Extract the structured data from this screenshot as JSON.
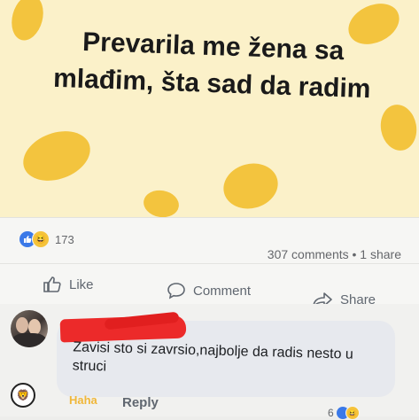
{
  "post": {
    "text": "Prevarila me žena sa mlađim, šta sad da radim",
    "reaction_count": "173",
    "stats_right": "307 comments • 1 share"
  },
  "actions": {
    "like": "Like",
    "comment": "Comment",
    "share": "Share"
  },
  "comment": {
    "text": "Zavisi sto si zavrsio,najbolje da radis nesto u struci",
    "haha_label": "Haha",
    "reply_label": "Reply",
    "reaction_count": "6"
  },
  "colors": {
    "post_background": "#fbf1c9",
    "egg_yolk": "#f3c43e",
    "like_blue": "#3b79e8",
    "redaction_red": "#ec2a2a"
  }
}
